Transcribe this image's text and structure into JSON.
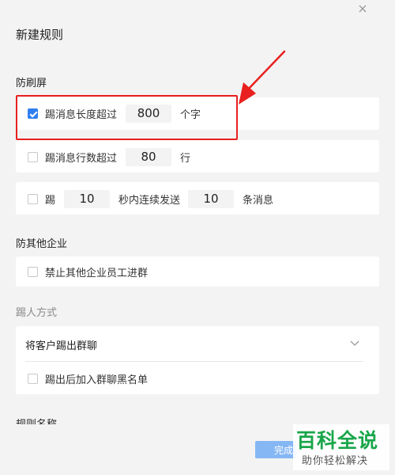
{
  "dialog": {
    "title": "新建规则"
  },
  "anti_spam": {
    "title": "防刷屏",
    "length_rule": {
      "checked": true,
      "prefix": "踢消息长度超过",
      "value": "800",
      "suffix": "个字"
    },
    "lines_rule": {
      "checked": false,
      "prefix": "踢消息行数超过",
      "value": "80",
      "suffix": "行"
    },
    "burst_rule": {
      "checked": false,
      "prefix": "踢",
      "seconds": "10",
      "middle": "秒内连续发送",
      "count": "10",
      "suffix": "条消息"
    }
  },
  "other_company": {
    "title": "防其他企业",
    "block_option": {
      "checked": false,
      "label": "禁止其他企业员工进群"
    }
  },
  "kick_method": {
    "title": "踢人方式",
    "selected": "将客户踢出群聊",
    "blacklist_option": {
      "checked": false,
      "label": "踢出后加入群聊黑名单"
    }
  },
  "rule_name": {
    "title": "规则名称"
  },
  "footer": {
    "confirm_label": "完成"
  },
  "watermark": {
    "main": "百科全说",
    "sub": "助你轻松解决"
  },
  "colors": {
    "accent": "#2f7ff0",
    "highlight": "#e8201f",
    "brand_green": "#19a64a"
  },
  "icons": {
    "close": "close-icon",
    "chevron": "chevron-down-icon",
    "check": "check-icon",
    "arrow": "arrow-annotation-icon"
  }
}
